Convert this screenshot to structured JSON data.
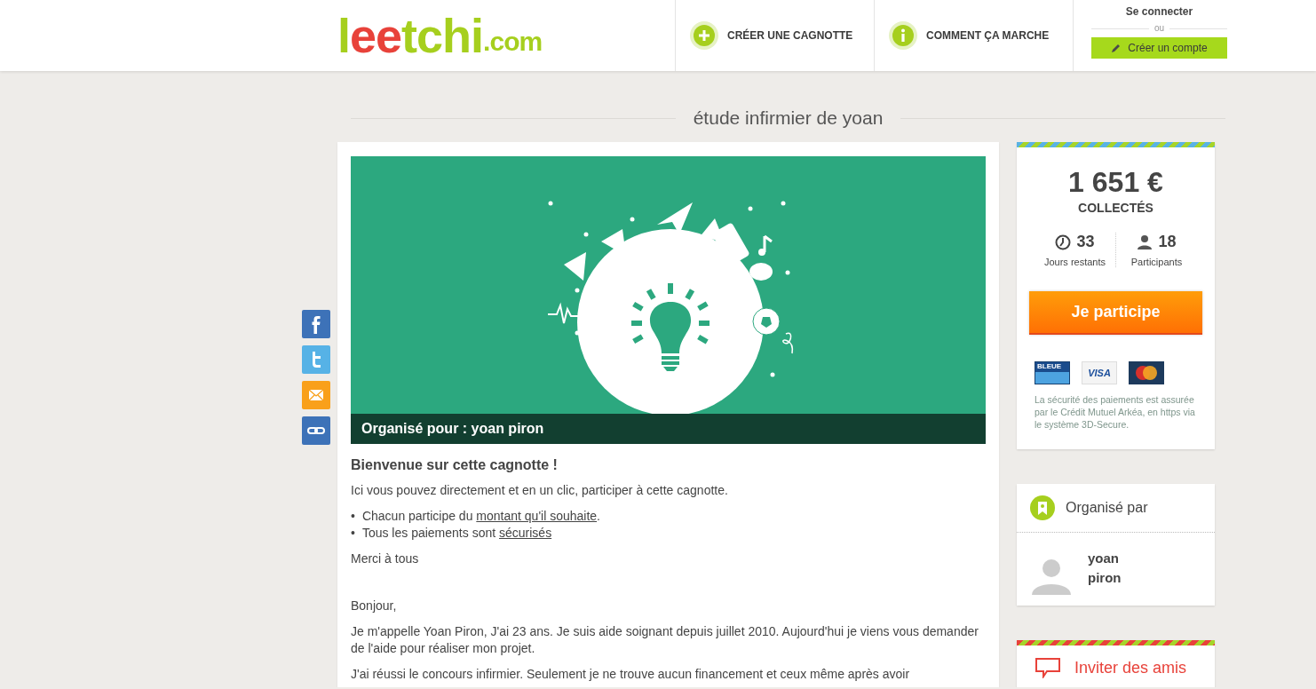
{
  "header": {
    "logo": [
      {
        "text": "l",
        "kind": "word",
        "color": "#a6cf1e"
      },
      {
        "text": "ee",
        "kind": "word",
        "color": "#e8423a"
      },
      {
        "text": "tchi",
        "kind": "word",
        "color": "#a6cf1e"
      },
      {
        "text": ".com",
        "kind": "domain",
        "color": "#a6cf1e"
      }
    ],
    "nav": [
      {
        "label": "CRÉER UNE CAGNOTTE",
        "kind": "plus"
      },
      {
        "label": "COMMENT ÇA MARCHE",
        "kind": "info"
      }
    ],
    "account": {
      "login": "Se connecter",
      "or": "ou",
      "signup": "Créer un compte"
    }
  },
  "share": [
    {
      "kind": "facebook"
    },
    {
      "kind": "twitter"
    },
    {
      "kind": "email"
    },
    {
      "kind": "link"
    }
  ],
  "page_title": "étude infirmier de yoan",
  "banner": {
    "caption": "Organisé pour : yoan piron"
  },
  "description": {
    "heading": "Bienvenue sur cette cagnotte !",
    "intro": "Ici vous pouvez directement et en un clic, participer à cette cagnotte.",
    "bullets": [
      {
        "marker": "•",
        "text": "Chacun participe du ",
        "link": "montant qu'il souhaite",
        "after": "."
      },
      {
        "marker": "•",
        "text": "Tous les paiements sont ",
        "link": "sécurisés"
      }
    ],
    "thanks": "Merci à tous",
    "paragraphs": [
      "Bonjour,",
      "Je m'appelle Yoan Piron, J'ai 23 ans. Je suis aide soignant depuis juillet 2010. Aujourd'hui je viens vous demander de l'aide pour réaliser mon projet.",
      "J'ai réussi le concours infirmier. Seulement je ne trouve aucun financement et ceux même après avoir"
    ]
  },
  "summary": {
    "amount": "1 651 €",
    "amount_label": "COLLECTÉS",
    "stats": [
      {
        "kind": "days",
        "value": "33",
        "label": "Jours restants"
      },
      {
        "kind": "participants",
        "value": "18",
        "label": "Participants"
      }
    ],
    "button": "Je participe",
    "payment_cards": [
      {
        "kind": "cb",
        "label": "BLEUE"
      },
      {
        "kind": "visa",
        "label": "VISA"
      },
      {
        "kind": "mastercard"
      }
    ],
    "security_note": "La sécurité des paiements est assurée par le Crédit Mutuel Arkéa, en https via le système 3D-Secure."
  },
  "organizer": {
    "title": "Organisé par",
    "name": "yoan piron"
  },
  "invite": {
    "label": "Inviter des amis"
  }
}
